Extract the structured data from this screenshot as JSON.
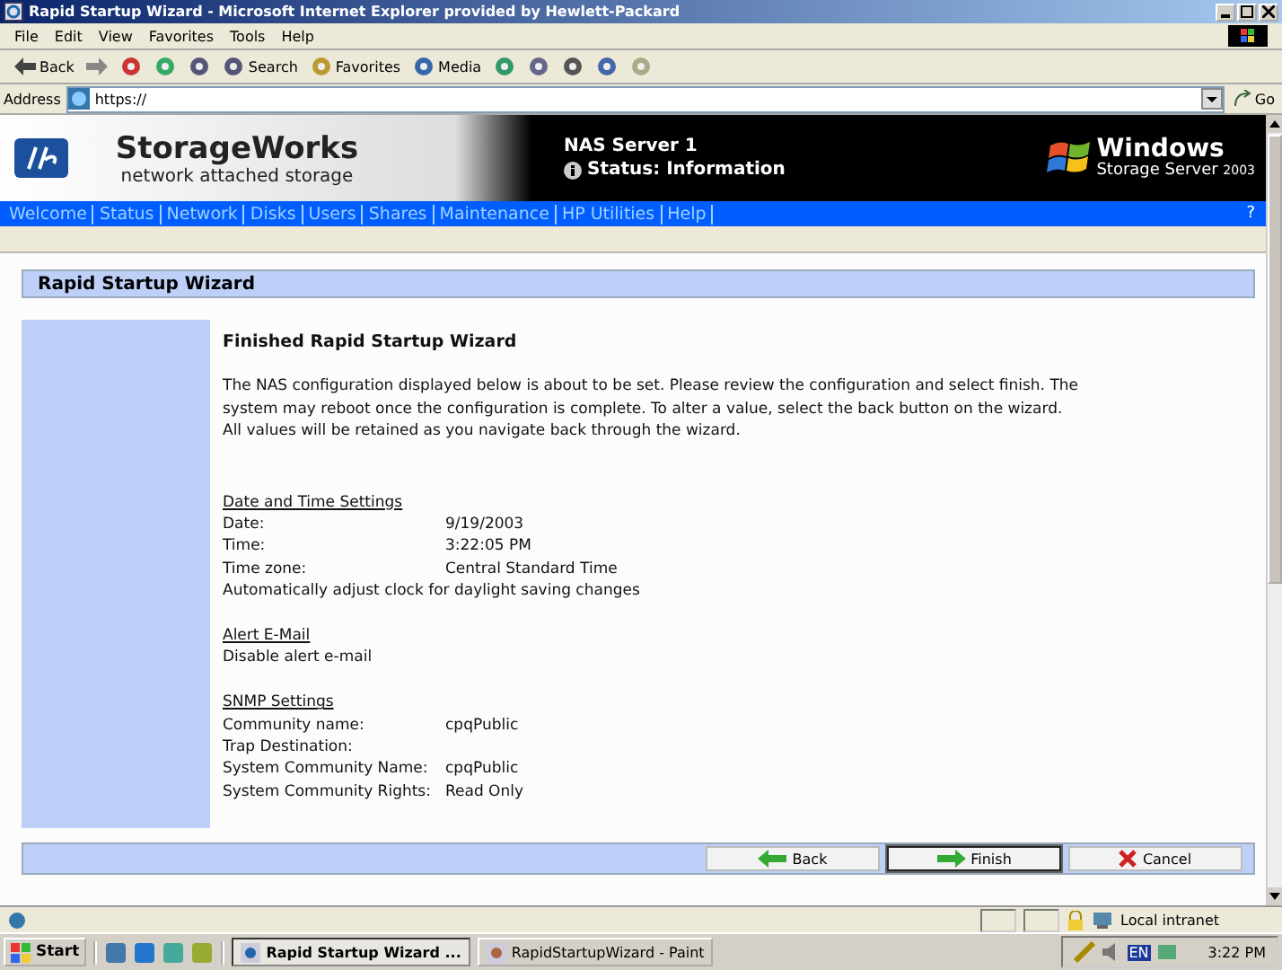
{
  "window": {
    "title": "Rapid Startup Wizard - Microsoft Internet Explorer provided by Hewlett-Packard"
  },
  "menu": [
    "File",
    "Edit",
    "View",
    "Favorites",
    "Tools",
    "Help"
  ],
  "toolbar": [
    {
      "kind": "back",
      "label": "Back"
    },
    {
      "kind": "forward"
    },
    {
      "kind": "stop"
    },
    {
      "kind": "refresh"
    },
    {
      "kind": "home"
    },
    {
      "kind": "search",
      "label": "Search"
    },
    {
      "kind": "favorites",
      "label": "Favorites"
    },
    {
      "kind": "media",
      "label": "Media"
    },
    {
      "kind": "history"
    },
    {
      "kind": "mail"
    },
    {
      "kind": "print"
    },
    {
      "kind": "edit"
    },
    {
      "kind": "discuss"
    }
  ],
  "address": {
    "label": "Address",
    "value": "https://",
    "go": "Go"
  },
  "header": {
    "brand": "StorageWorks",
    "subtitle": "network attached storage",
    "server": "NAS Server 1",
    "status": "Status: Information",
    "os_name": "Windows",
    "os_edition": "Storage Server",
    "os_year": "2003"
  },
  "nav": {
    "items": [
      "Welcome",
      "Status",
      "Network",
      "Disks",
      "Users",
      "Shares",
      "Maintenance",
      "HP Utilities",
      "Help"
    ],
    "help": "?"
  },
  "panel": {
    "title": "Rapid Startup Wizard",
    "heading": "Finished Rapid Startup Wizard",
    "intro": "The NAS configuration displayed below is about to be set. Please review the configuration and select finish. The system may reboot once the configuration is complete. To alter a value, select the back button on the wizard. All values will be retained as you navigate back through the wizard.",
    "sections": [
      {
        "title": "Date and Time Settings",
        "rows": [
          {
            "label": "Date:",
            "value": "9/19/2003"
          },
          {
            "label": "Time:",
            "value": "3:22:05 PM"
          },
          {
            "label": "Time zone:",
            "value": "Central Standard Time"
          },
          {
            "label": "Automatically adjust clock for daylight saving changes"
          }
        ]
      },
      {
        "title": "Alert E-Mail",
        "rows": [
          {
            "label": "Disable alert e-mail"
          }
        ]
      },
      {
        "title": "SNMP Settings",
        "rows": [
          {
            "label": "Community name:",
            "value": "cpqPublic"
          },
          {
            "label": "Trap Destination:"
          },
          {
            "label": "System Community Name:",
            "value": "cpqPublic"
          },
          {
            "label": "System Community Rights:",
            "value": "Read Only"
          }
        ]
      }
    ]
  },
  "buttons": [
    {
      "kind": "back",
      "label": "Back",
      "selected": false
    },
    {
      "kind": "finish",
      "label": "Finish",
      "selected": true
    },
    {
      "kind": "cancel",
      "label": "Cancel",
      "selected": false
    }
  ],
  "status_bar": {
    "zone": "Local intranet"
  },
  "taskbar": {
    "start": "Start",
    "tasks": [
      {
        "label": "Rapid Startup Wizard ...",
        "selected": true
      },
      {
        "label": "RapidStartupWizard - Paint",
        "selected": false
      }
    ],
    "language": "EN",
    "clock": "3:22 PM"
  }
}
